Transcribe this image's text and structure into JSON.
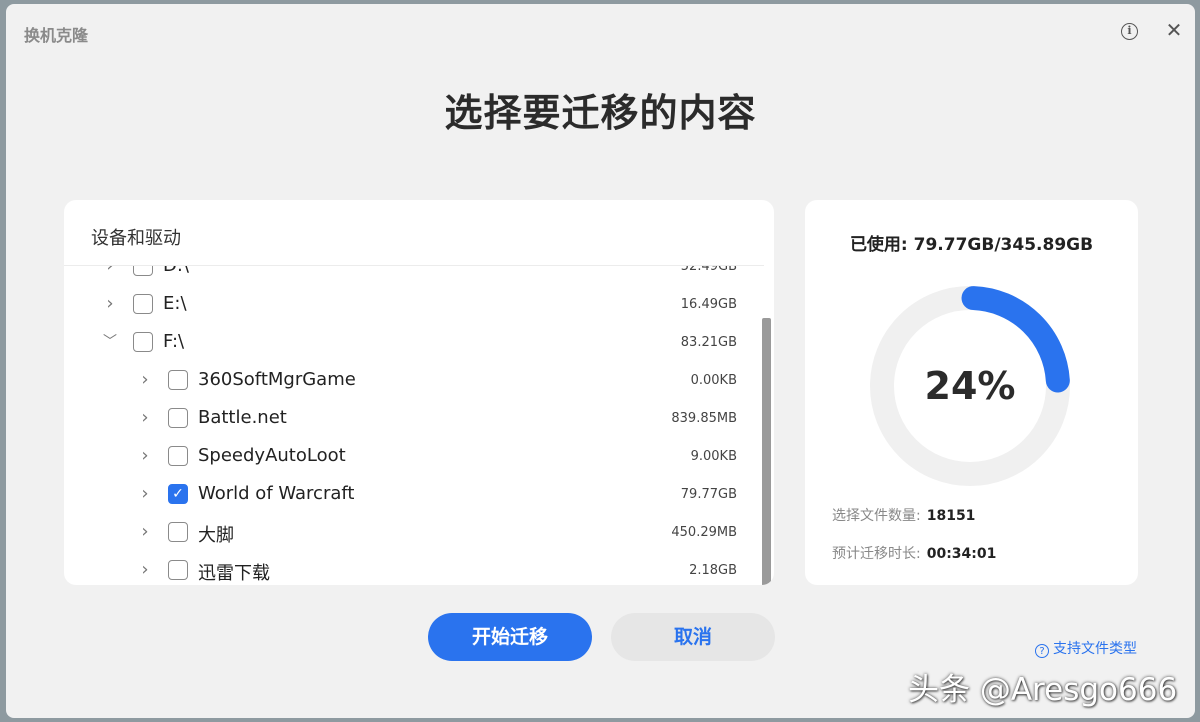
{
  "window": {
    "title": "换机克隆"
  },
  "header": {
    "title": "选择要迁移的内容"
  },
  "left_panel": {
    "heading": "设备和驱动",
    "items": [
      {
        "name": "D:\\",
        "size": "52.49GB",
        "checked": false,
        "expanded": false,
        "level": 0
      },
      {
        "name": "E:\\",
        "size": "16.49GB",
        "checked": false,
        "expanded": false,
        "level": 0
      },
      {
        "name": "F:\\",
        "size": "83.21GB",
        "checked": false,
        "expanded": true,
        "level": 0
      },
      {
        "name": "360SoftMgrGame",
        "size": "0.00KB",
        "checked": false,
        "expanded": false,
        "level": 1
      },
      {
        "name": "Battle.net",
        "size": "839.85MB",
        "checked": false,
        "expanded": false,
        "level": 1
      },
      {
        "name": "SpeedyAutoLoot",
        "size": "9.00KB",
        "checked": false,
        "expanded": false,
        "level": 1
      },
      {
        "name": "World of Warcraft",
        "size": "79.77GB",
        "checked": true,
        "expanded": false,
        "level": 1
      },
      {
        "name": "大脚",
        "size": "450.29MB",
        "checked": false,
        "expanded": false,
        "level": 1
      },
      {
        "name": "迅雷下载",
        "size": "2.18GB",
        "checked": false,
        "expanded": false,
        "level": 1
      }
    ]
  },
  "right_panel": {
    "usage_label": "已使用: 79.77GB/345.89GB",
    "percent_text": "24%",
    "percent_value": 0.24,
    "file_count_label": "选择文件数量:",
    "file_count_value": "18151",
    "eta_label": "预计迁移时长:",
    "eta_value": "00:34:01",
    "accent_color": "#2a73ee",
    "track_color": "#f0f0f0"
  },
  "actions": {
    "start_label": "开始迁移",
    "cancel_label": "取消",
    "support_label": "支持文件类型"
  },
  "watermark": "头条 @Aresgo666"
}
